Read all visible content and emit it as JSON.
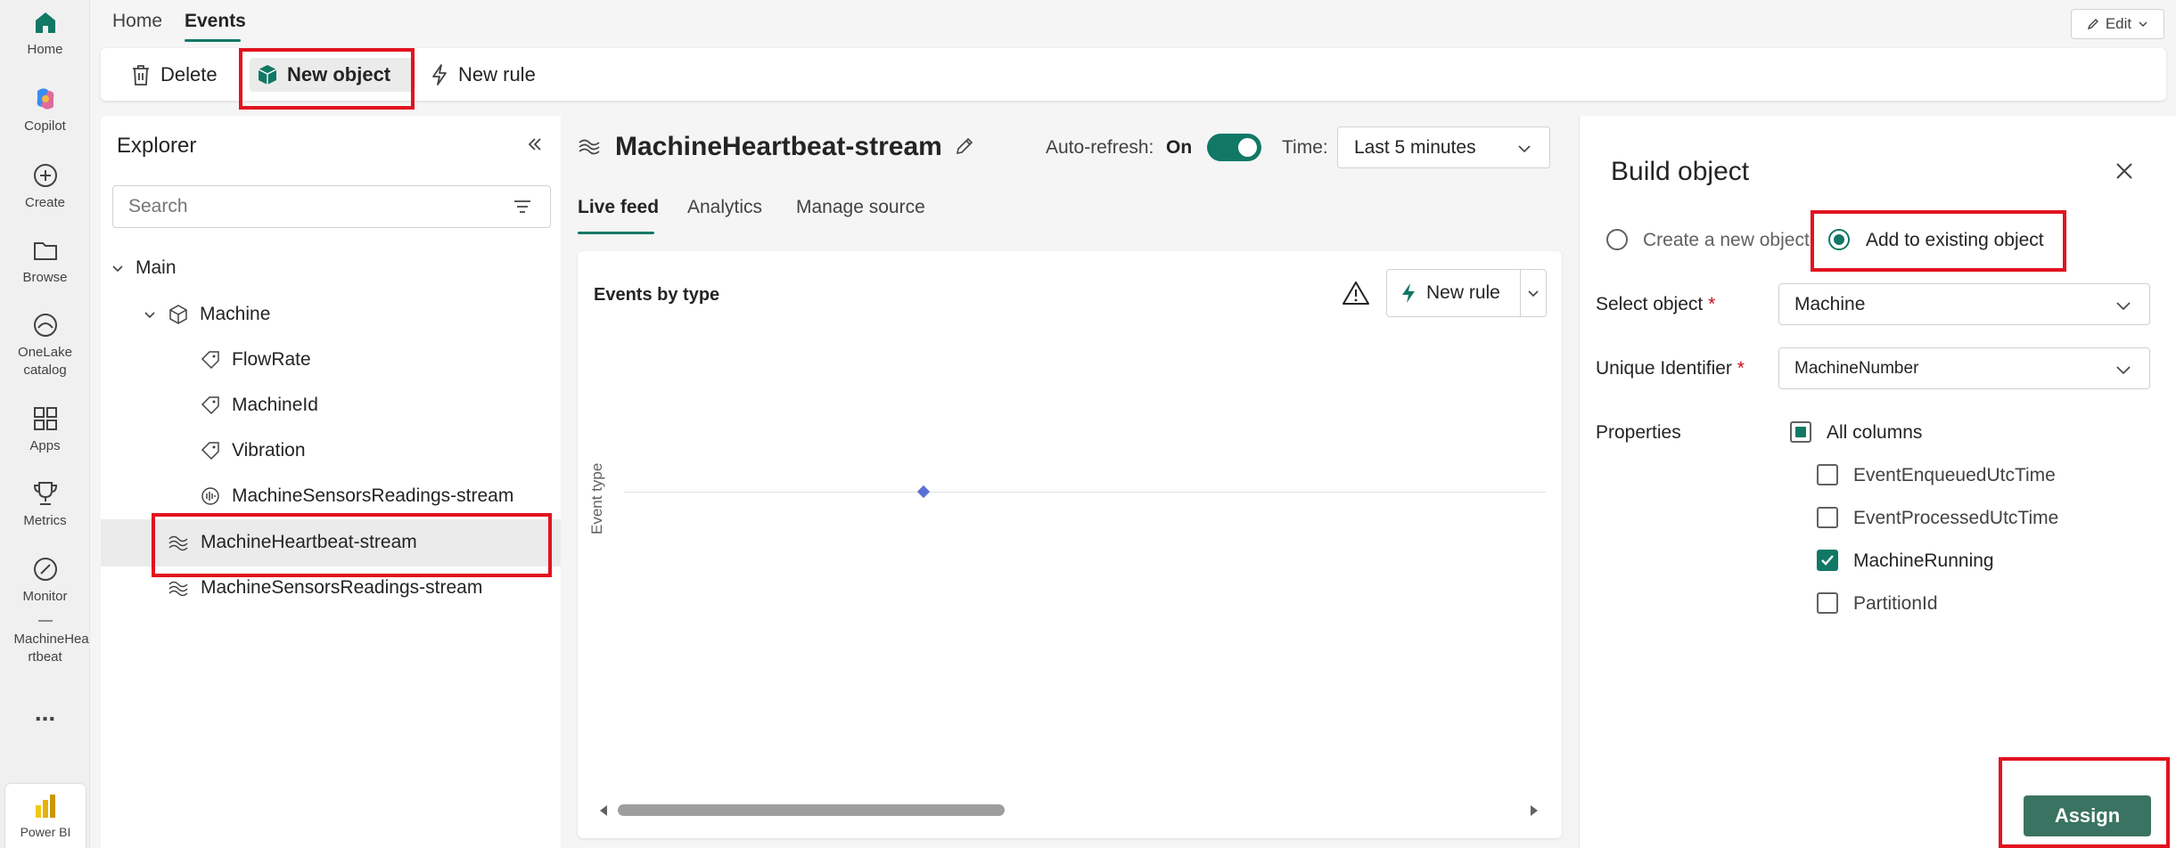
{
  "rail": {
    "items": [
      {
        "label": "Home",
        "icon": "home-icon"
      },
      {
        "label": "Copilot",
        "icon": "copilot-icon"
      },
      {
        "label": "Create",
        "icon": "create-icon"
      },
      {
        "label": "Browse",
        "icon": "browse-icon"
      },
      {
        "label": "OneLake catalog",
        "icon": "onelake-icon"
      },
      {
        "label": "Apps",
        "icon": "apps-icon"
      },
      {
        "label": "Metrics",
        "icon": "trophy-icon"
      },
      {
        "label": "Monitor",
        "icon": "monitor-icon"
      },
      {
        "label": "MachineHea rtbeat",
        "icon": "item-icon"
      },
      {
        "label": "...",
        "icon": "more-icon"
      },
      {
        "label": "Power BI",
        "icon": "powerbi-icon"
      }
    ]
  },
  "top_tabs": {
    "home": "Home",
    "events": "Events"
  },
  "edit_button": {
    "label": "Edit"
  },
  "toolbar": {
    "delete": "Delete",
    "new_object": "New object",
    "new_rule": "New rule"
  },
  "explorer": {
    "title": "Explorer",
    "search_placeholder": "Search",
    "tree": {
      "main": "Main",
      "machine": "Machine",
      "flowrate": "FlowRate",
      "machineid": "MachineId",
      "vibration": "Vibration",
      "sensor_child": "MachineSensorsReadings-stream",
      "heartbeat": "MachineHeartbeat-stream",
      "sensor_root": "MachineSensorsReadings-stream"
    }
  },
  "center": {
    "title": "MachineHeartbeat-stream",
    "auto_refresh_label": "Auto-refresh:",
    "auto_refresh_value": "On",
    "time_label": "Time:",
    "time_value": "Last 5 minutes",
    "tabs": {
      "live_feed": "Live feed",
      "analytics": "Analytics",
      "manage_source": "Manage source"
    },
    "chart": {
      "title": "Events by type",
      "new_rule": "New rule",
      "y_axis_label": "Event type"
    }
  },
  "chart_data": {
    "type": "scatter",
    "title": "Events by type",
    "xlabel": "",
    "ylabel": "Event type",
    "series": [
      {
        "values": [
          1
        ]
      }
    ],
    "grid": false
  },
  "build_panel": {
    "title": "Build object",
    "radio_create": "Create a new object",
    "radio_add": "Add to existing object",
    "select_object_label": "Select object",
    "select_object_value": "Machine",
    "unique_id_label": "Unique Identifier",
    "unique_id_value": "MachineNumber",
    "required_mark": "*",
    "properties_label": "Properties",
    "all_columns": "All columns",
    "columns": [
      {
        "name": "EventEnqueuedUtcTime",
        "checked": false
      },
      {
        "name": "EventProcessedUtcTime",
        "checked": false
      },
      {
        "name": "MachineRunning",
        "checked": true
      },
      {
        "name": "PartitionId",
        "checked": false
      }
    ],
    "assign": "Assign"
  },
  "colors": {
    "accent": "#117865",
    "highlight": "#e2131f",
    "assign": "#3a7361",
    "point": "#5b6fd6"
  }
}
